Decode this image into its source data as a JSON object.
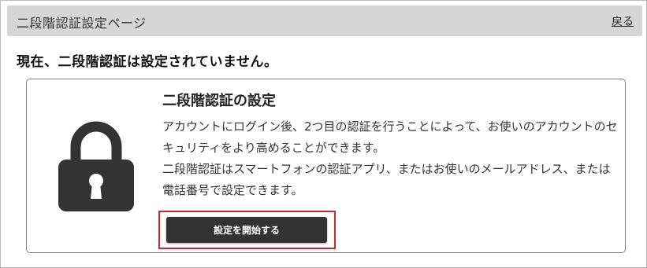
{
  "header": {
    "title": "二段階認証設定ページ",
    "back_label": "戻る"
  },
  "status": {
    "message": "現在、二段階認証は設定されていません。"
  },
  "card": {
    "icon": "lock-icon",
    "title": "二段階認証の設定",
    "description": [
      "アカウントにログイン後、2つ目の認証を行うことによって、お使いのアカウントのセキュリティをより高めることができます。",
      "二段階認証はスマートフォンの認証アプリ、またはお使いのメールアドレス、または電話番号で設定できます。"
    ],
    "button_label": "設定を開始する"
  },
  "colors": {
    "header_bg": "#d6d6d6",
    "button_bg": "#333333",
    "highlight": "#d0252b",
    "icon": "#333333"
  }
}
